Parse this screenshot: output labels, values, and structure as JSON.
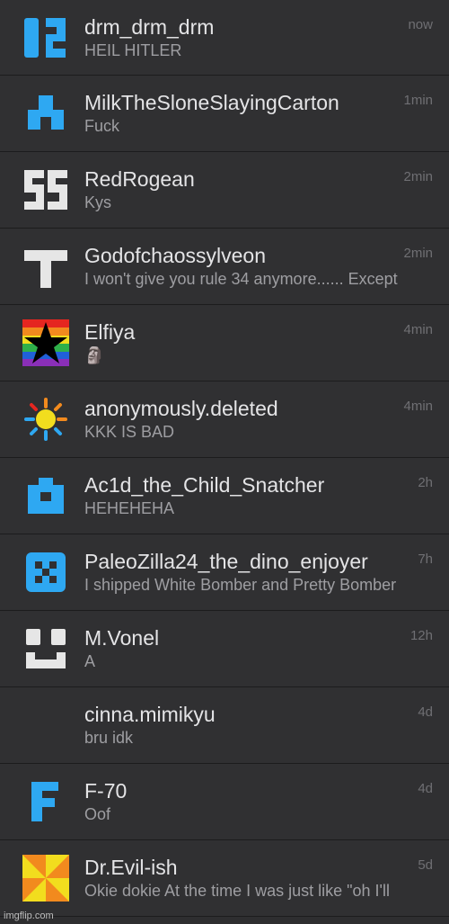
{
  "conversations": [
    {
      "name": "drm_drm_drm",
      "message": "HEIL HITLER",
      "time": "now",
      "icon": "pixel-glyph-icon",
      "color": "#2ea8f2"
    },
    {
      "name": "MilkTheSloneSlayingCarton",
      "message": "Fuck",
      "time": "1min",
      "icon": "pixel-glyph-icon",
      "color": "#2ea8f2"
    },
    {
      "name": "RedRogean",
      "message": "Kys",
      "time": "2min",
      "icon": "pixel-glyph-icon",
      "color": "#e6e6e6"
    },
    {
      "name": "Godofchaossylveon",
      "message": "I won't give you rule 34 anymore...... Except",
      "time": "2min",
      "icon": "cross-icon",
      "color": "#e6e6e6"
    },
    {
      "name": "Elfiya",
      "message": "🗿",
      "time": "4min",
      "icon": "rainbow-star-icon",
      "color": "#000000"
    },
    {
      "name": "anonymously.deleted",
      "message": "KKK IS BAD",
      "time": "4min",
      "icon": "sun-icon",
      "color": "#f2c21e"
    },
    {
      "name": "Ac1d_the_Child_Snatcher",
      "message": "HEHEHEHA",
      "time": "2h",
      "icon": "pixel-glyph-icon",
      "color": "#2ea8f2"
    },
    {
      "name": "PaleoZilla24_the_dino_enjoyer",
      "message": "I shipped White Bomber and Pretty Bomber",
      "time": "7h",
      "icon": "pixel-checker-icon",
      "color": "#2ea8f2"
    },
    {
      "name": "M.Vonel",
      "message": "A",
      "time": "12h",
      "icon": "pixel-glyph-icon",
      "color": "#e6e6e6"
    },
    {
      "name": "cinna.mimikyu",
      "message": "bru idk",
      "time": "4d",
      "icon": "blank-avatar",
      "color": "#303032"
    },
    {
      "name": "F-70",
      "message": "Oof",
      "time": "4d",
      "icon": "letter-f-icon",
      "color": "#2ea8f2"
    },
    {
      "name": "Dr.Evil-ish",
      "message": "Okie dokie At the time I was just like \"oh I'll",
      "time": "5d",
      "icon": "pinwheel-icon",
      "color": "#f28a1e"
    }
  ],
  "watermark": "imgflip.com"
}
